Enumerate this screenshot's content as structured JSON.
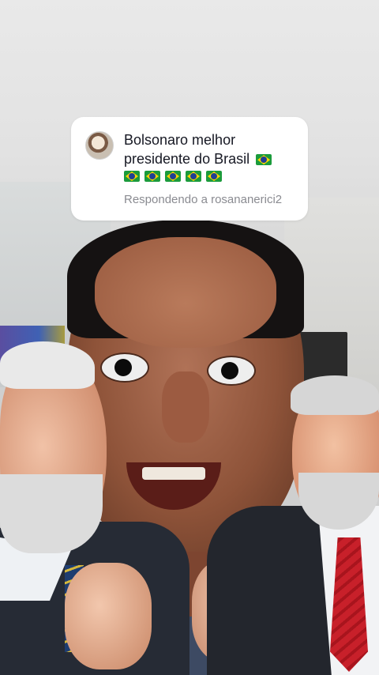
{
  "reply_card": {
    "comment_text": "Bolsonaro melhor presidente do Brasil",
    "emoji_name": "brazil-flag",
    "trailing_flag_count": 1,
    "second_row_flag_count": 5,
    "replying_to": "Respondendo a rosananerici2"
  }
}
